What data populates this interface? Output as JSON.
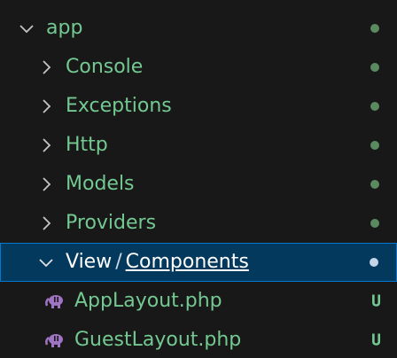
{
  "explorer": {
    "root": {
      "label": "app"
    },
    "folders": [
      {
        "label": "Console"
      },
      {
        "label": "Exceptions"
      },
      {
        "label": "Http"
      },
      {
        "label": "Models"
      },
      {
        "label": "Providers"
      }
    ],
    "selected_folder": {
      "part1": "View",
      "separator": "/",
      "part2": "Components"
    },
    "files": [
      {
        "label": "AppLayout.php",
        "status": "U"
      },
      {
        "label": "GuestLayout.php",
        "status": "U"
      }
    ]
  },
  "colors": {
    "background": "#181818",
    "untracked_text": "#73c991",
    "selection_bg": "#04395e",
    "selection_border": "#0078d4",
    "php_icon": "#a074c4"
  }
}
